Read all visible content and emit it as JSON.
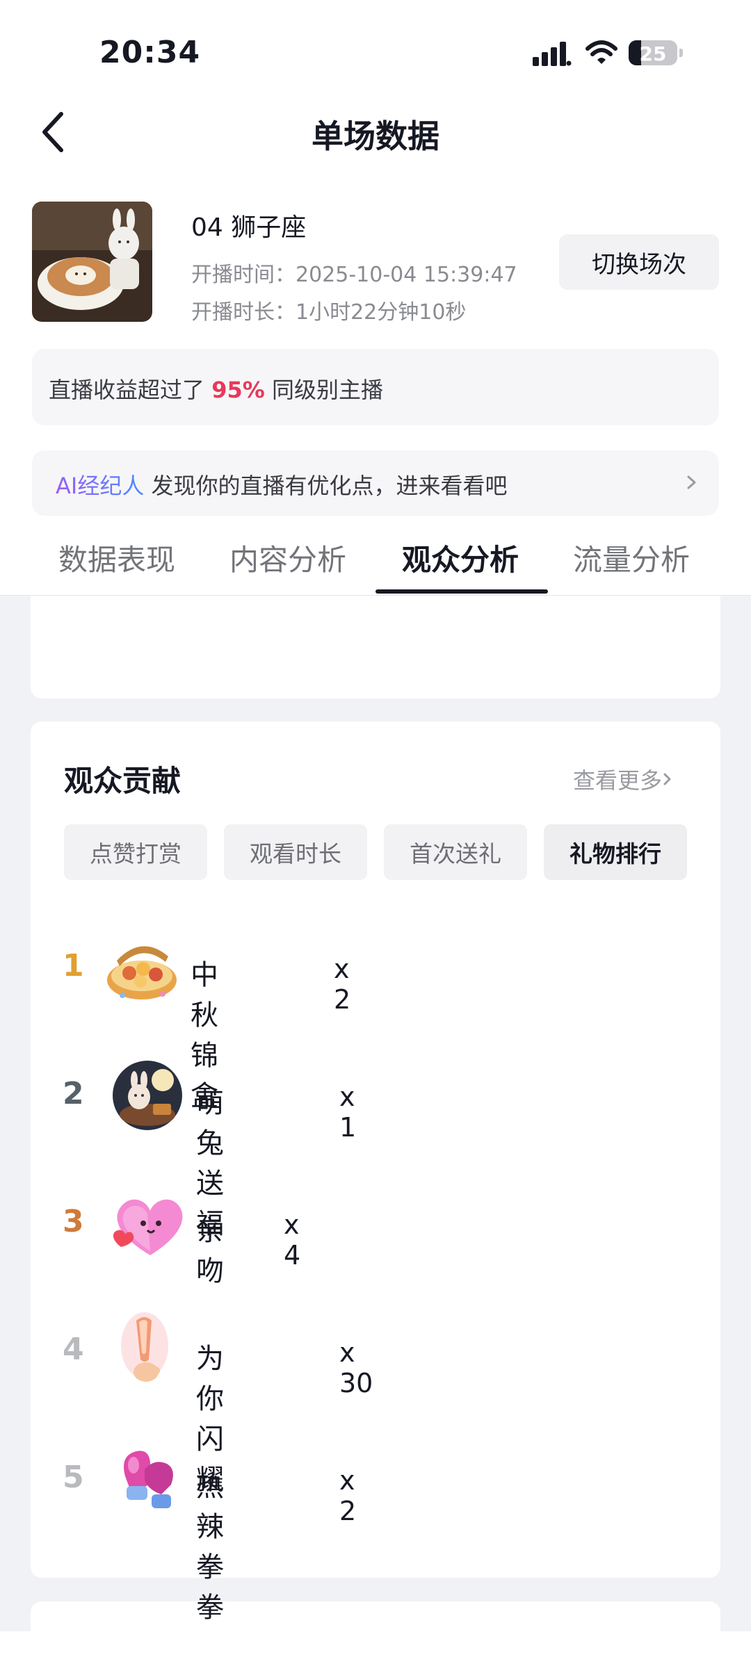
{
  "status_bar": {
    "time": "20:34",
    "battery": "25"
  },
  "header": {
    "title": "单场数据"
  },
  "session": {
    "name": "04 狮子座",
    "start_time": "开播时间：2025-10-04 15:39:47",
    "duration": "开播时长：1小时22分钟10秒",
    "switch_label": "切换场次"
  },
  "income_banner": {
    "prefix": "直播收益超过了",
    "percent": "95%",
    "suffix": "同级别主播"
  },
  "ai_banner": {
    "brand": "AI经纪人",
    "text": "发现你的直播有优化点，进来看看吧"
  },
  "tabs": [
    {
      "label": "数据表现"
    },
    {
      "label": "内容分析"
    },
    {
      "label": "观众分析"
    },
    {
      "label": "流量分析"
    }
  ],
  "active_tab": "观众分析",
  "contribution": {
    "title": "观众贡献",
    "see_more": "查看更多",
    "chips": [
      {
        "label": "点赞打赏"
      },
      {
        "label": "观看时长"
      },
      {
        "label": "首次送礼"
      },
      {
        "label": "礼物排行"
      }
    ],
    "active_chip": "礼物排行",
    "gifts": [
      {
        "rank": "1",
        "name": "中秋锦盒",
        "count": "x 2",
        "icon": "mooncake-box-icon",
        "rank_color": "#e0a032"
      },
      {
        "rank": "2",
        "name": "萌兔送福",
        "count": "x 1",
        "icon": "moon-rabbit-icon",
        "rank_color": "#55616b"
      },
      {
        "rank": "3",
        "name": "亲吻",
        "count": "x 4",
        "icon": "pink-heart-icon",
        "rank_color": "#d07a3a"
      },
      {
        "rank": "4",
        "name": "为你闪耀",
        "count": "x 30",
        "icon": "glow-stick-icon",
        "rank_color": "#b9babe"
      },
      {
        "rank": "5",
        "name": "热辣拳拳",
        "count": "x 2",
        "icon": "boxing-glove-icon",
        "rank_color": "#b9babe"
      }
    ]
  }
}
